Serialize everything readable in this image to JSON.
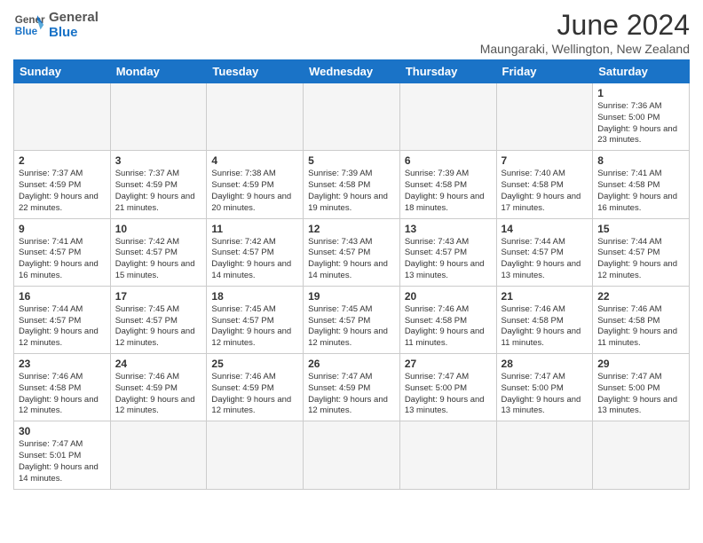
{
  "header": {
    "logo_general": "General",
    "logo_blue": "Blue",
    "title": "June 2024",
    "subtitle": "Maungaraki, Wellington, New Zealand"
  },
  "days_of_week": [
    "Sunday",
    "Monday",
    "Tuesday",
    "Wednesday",
    "Thursday",
    "Friday",
    "Saturday"
  ],
  "weeks": [
    [
      {
        "date": "",
        "info": ""
      },
      {
        "date": "",
        "info": ""
      },
      {
        "date": "",
        "info": ""
      },
      {
        "date": "",
        "info": ""
      },
      {
        "date": "",
        "info": ""
      },
      {
        "date": "",
        "info": ""
      },
      {
        "date": "1",
        "info": "Sunrise: 7:36 AM\nSunset: 5:00 PM\nDaylight: 9 hours\nand 23 minutes."
      }
    ],
    [
      {
        "date": "2",
        "info": "Sunrise: 7:37 AM\nSunset: 4:59 PM\nDaylight: 9 hours\nand 22 minutes."
      },
      {
        "date": "3",
        "info": "Sunrise: 7:37 AM\nSunset: 4:59 PM\nDaylight: 9 hours\nand 21 minutes."
      },
      {
        "date": "4",
        "info": "Sunrise: 7:38 AM\nSunset: 4:59 PM\nDaylight: 9 hours\nand 20 minutes."
      },
      {
        "date": "5",
        "info": "Sunrise: 7:39 AM\nSunset: 4:58 PM\nDaylight: 9 hours\nand 19 minutes."
      },
      {
        "date": "6",
        "info": "Sunrise: 7:39 AM\nSunset: 4:58 PM\nDaylight: 9 hours\nand 18 minutes."
      },
      {
        "date": "7",
        "info": "Sunrise: 7:40 AM\nSunset: 4:58 PM\nDaylight: 9 hours\nand 17 minutes."
      },
      {
        "date": "8",
        "info": "Sunrise: 7:41 AM\nSunset: 4:58 PM\nDaylight: 9 hours\nand 16 minutes."
      }
    ],
    [
      {
        "date": "9",
        "info": "Sunrise: 7:41 AM\nSunset: 4:57 PM\nDaylight: 9 hours\nand 16 minutes."
      },
      {
        "date": "10",
        "info": "Sunrise: 7:42 AM\nSunset: 4:57 PM\nDaylight: 9 hours\nand 15 minutes."
      },
      {
        "date": "11",
        "info": "Sunrise: 7:42 AM\nSunset: 4:57 PM\nDaylight: 9 hours\nand 14 minutes."
      },
      {
        "date": "12",
        "info": "Sunrise: 7:43 AM\nSunset: 4:57 PM\nDaylight: 9 hours\nand 14 minutes."
      },
      {
        "date": "13",
        "info": "Sunrise: 7:43 AM\nSunset: 4:57 PM\nDaylight: 9 hours\nand 13 minutes."
      },
      {
        "date": "14",
        "info": "Sunrise: 7:44 AM\nSunset: 4:57 PM\nDaylight: 9 hours\nand 13 minutes."
      },
      {
        "date": "15",
        "info": "Sunrise: 7:44 AM\nSunset: 4:57 PM\nDaylight: 9 hours\nand 12 minutes."
      }
    ],
    [
      {
        "date": "16",
        "info": "Sunrise: 7:44 AM\nSunset: 4:57 PM\nDaylight: 9 hours\nand 12 minutes."
      },
      {
        "date": "17",
        "info": "Sunrise: 7:45 AM\nSunset: 4:57 PM\nDaylight: 9 hours\nand 12 minutes."
      },
      {
        "date": "18",
        "info": "Sunrise: 7:45 AM\nSunset: 4:57 PM\nDaylight: 9 hours\nand 12 minutes."
      },
      {
        "date": "19",
        "info": "Sunrise: 7:45 AM\nSunset: 4:57 PM\nDaylight: 9 hours\nand 12 minutes."
      },
      {
        "date": "20",
        "info": "Sunrise: 7:46 AM\nSunset: 4:58 PM\nDaylight: 9 hours\nand 11 minutes."
      },
      {
        "date": "21",
        "info": "Sunrise: 7:46 AM\nSunset: 4:58 PM\nDaylight: 9 hours\nand 11 minutes."
      },
      {
        "date": "22",
        "info": "Sunrise: 7:46 AM\nSunset: 4:58 PM\nDaylight: 9 hours\nand 11 minutes."
      }
    ],
    [
      {
        "date": "23",
        "info": "Sunrise: 7:46 AM\nSunset: 4:58 PM\nDaylight: 9 hours\nand 12 minutes."
      },
      {
        "date": "24",
        "info": "Sunrise: 7:46 AM\nSunset: 4:59 PM\nDaylight: 9 hours\nand 12 minutes."
      },
      {
        "date": "25",
        "info": "Sunrise: 7:46 AM\nSunset: 4:59 PM\nDaylight: 9 hours\nand 12 minutes."
      },
      {
        "date": "26",
        "info": "Sunrise: 7:47 AM\nSunset: 4:59 PM\nDaylight: 9 hours\nand 12 minutes."
      },
      {
        "date": "27",
        "info": "Sunrise: 7:47 AM\nSunset: 5:00 PM\nDaylight: 9 hours\nand 13 minutes."
      },
      {
        "date": "28",
        "info": "Sunrise: 7:47 AM\nSunset: 5:00 PM\nDaylight: 9 hours\nand 13 minutes."
      },
      {
        "date": "29",
        "info": "Sunrise: 7:47 AM\nSunset: 5:00 PM\nDaylight: 9 hours\nand 13 minutes."
      }
    ],
    [
      {
        "date": "30",
        "info": "Sunrise: 7:47 AM\nSunset: 5:01 PM\nDaylight: 9 hours\nand 14 minutes."
      },
      {
        "date": "",
        "info": ""
      },
      {
        "date": "",
        "info": ""
      },
      {
        "date": "",
        "info": ""
      },
      {
        "date": "",
        "info": ""
      },
      {
        "date": "",
        "info": ""
      },
      {
        "date": "",
        "info": ""
      }
    ]
  ]
}
